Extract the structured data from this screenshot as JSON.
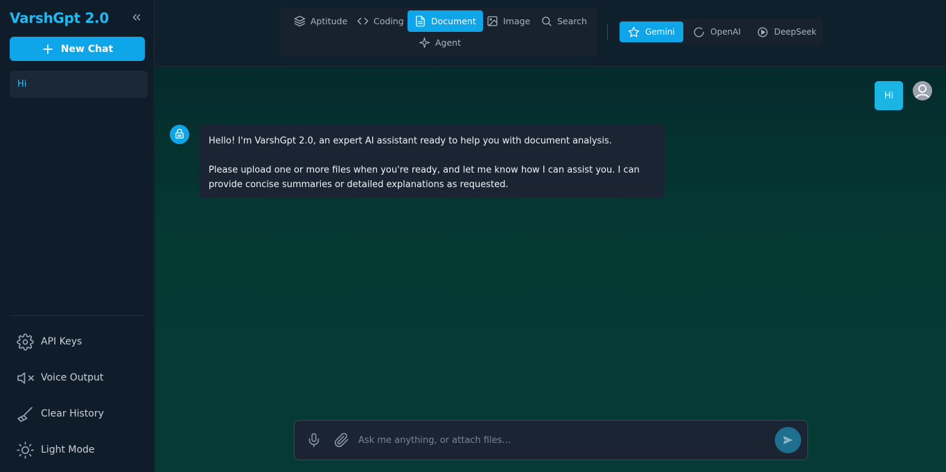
{
  "app": {
    "brand": "VarshGpt 2.0",
    "colors": {
      "accent": "#0ea5e9",
      "brand_text": "#22b8f0",
      "sidebar_bg": "#0f1c2a",
      "chat_bg": "#053a33",
      "bubble_bg": "#1b2433"
    }
  },
  "sidebar": {
    "collapse_icon": "chevrons-left-icon",
    "new_chat_label": "New Chat",
    "chats": [
      {
        "title": "Hi",
        "active": true
      }
    ],
    "menu": [
      {
        "label": "API Keys",
        "icon": "gear-icon"
      },
      {
        "label": "Voice Output",
        "icon": "speaker-muted-icon"
      },
      {
        "label": "Clear History",
        "icon": "broom-icon"
      },
      {
        "label": "Light Mode",
        "icon": "sun-icon"
      }
    ]
  },
  "topbar": {
    "modes": [
      {
        "label": "Aptitude",
        "icon": "layers-icon",
        "active": false
      },
      {
        "label": "Coding",
        "icon": "code-icon",
        "active": false
      },
      {
        "label": "Document",
        "icon": "document-icon",
        "active": true
      },
      {
        "label": "Image",
        "icon": "image-icon",
        "active": false
      },
      {
        "label": "Search",
        "icon": "search-icon",
        "active": false
      },
      {
        "label": "Agent",
        "icon": "sparkle-icon",
        "active": false
      }
    ],
    "models": [
      {
        "label": "Gemini",
        "icon": "star-icon",
        "active": true
      },
      {
        "label": "OpenAI",
        "icon": "refresh-icon",
        "active": false
      },
      {
        "label": "DeepSeek",
        "icon": "deepseek-icon",
        "active": false
      }
    ]
  },
  "chat": {
    "messages": [
      {
        "role": "user",
        "text": "Hi"
      },
      {
        "role": "assistant",
        "paragraphs": [
          "Hello! I'm VarshGpt 2.0, an expert AI assistant ready to help you with document analysis.",
          "Please upload one or more files when you're ready, and let me know how I can assist you. I can provide concise summaries or detailed explanations as requested."
        ]
      }
    ]
  },
  "composer": {
    "placeholder": "Ask me anything, or attach files...",
    "value": ""
  }
}
